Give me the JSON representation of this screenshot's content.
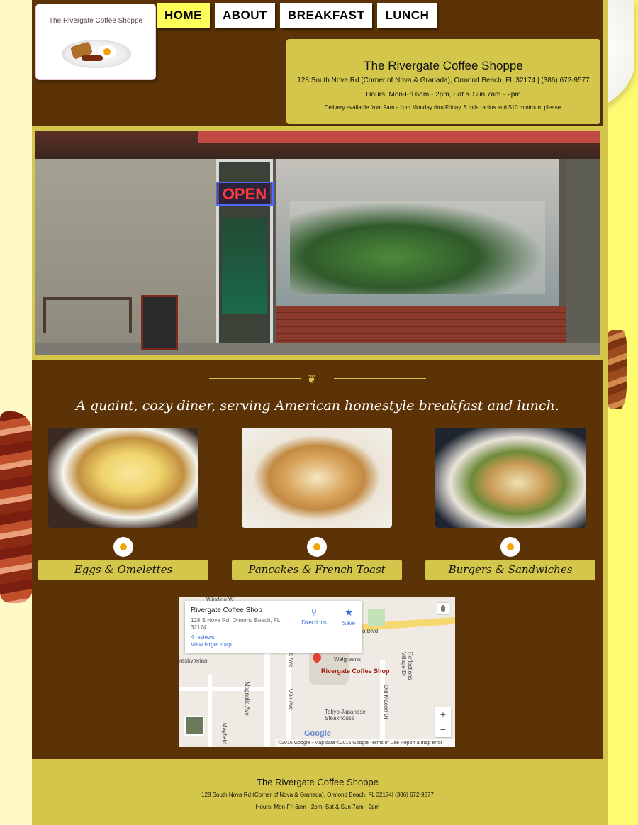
{
  "site": {
    "logo_title": "The Rivergate Coffee Shoppe"
  },
  "nav": {
    "items": [
      {
        "label": "HOME",
        "active": true
      },
      {
        "label": "ABOUT",
        "active": false
      },
      {
        "label": "BREAKFAST",
        "active": false
      },
      {
        "label": "LUNCH",
        "active": false
      }
    ]
  },
  "header_info": {
    "name": "The Rivergate Coffee Shoppe",
    "address": "128 South Nova Rd (Corner of Nova & Granada), Ormond Beach, FL 32174 | (386) 672-9577",
    "hours": "Hours: Mon-Fri 6am - 2pm, Sat & Sun 7am - 2pm",
    "delivery": "Delivery available from 9am - 1pm Monday thru Friday. 5 mile radius and $10 minimum please."
  },
  "hero": {
    "open_sign": "OPEN"
  },
  "tagline": "A quaint, cozy diner, serving American homestyle breakfast and lunch.",
  "categories": [
    {
      "label": "Eggs & Omelettes"
    },
    {
      "label": "Pancakes & French Toast"
    },
    {
      "label": "Burgers & Sandwiches"
    }
  ],
  "map": {
    "place_title": "Rivergate Coffee Shop",
    "address": "128 S Nova Rd, Ormond Beach, FL 32174",
    "reviews": "4 reviews",
    "larger_map": "View larger map",
    "directions": "Directions",
    "save": "Save",
    "pin_label": "Rivergate Coffee Shop",
    "walgreens": "Walgreens",
    "tokyo": "Tokyo Japanese Steakhouse",
    "road_blvd": "a Blvd",
    "street_magnolia": "Magnolia Ave",
    "street_oak": "Oak Ave",
    "street_oak2": "k Ave",
    "street_macon": "Old Macon Dr",
    "street_reflections": "Reflections Village Dr",
    "street_mayfield": "Mayfield",
    "presbyterian": "resbyterian",
    "winding": "Winding W",
    "google": "Google",
    "footer_text": "©2015 Google - Map data ©2015 Google    Terms of Use    Report a map error",
    "zoom_in": "+",
    "zoom_out": "−"
  },
  "footer": {
    "name": "The Rivergate Coffee Shoppe",
    "address": "128 South Nova Rd (Corner of Nova & Granada), Ormond Beach, FL 32174| (386) 672-9577",
    "hours": "Hours: Mon-Fri 6am - 2pm, Sat & Sun 7am - 2pm"
  },
  "colors": {
    "page_bg": "#5c3306",
    "accent_gold": "#d4c64a",
    "nav_active": "#ffff5a"
  }
}
